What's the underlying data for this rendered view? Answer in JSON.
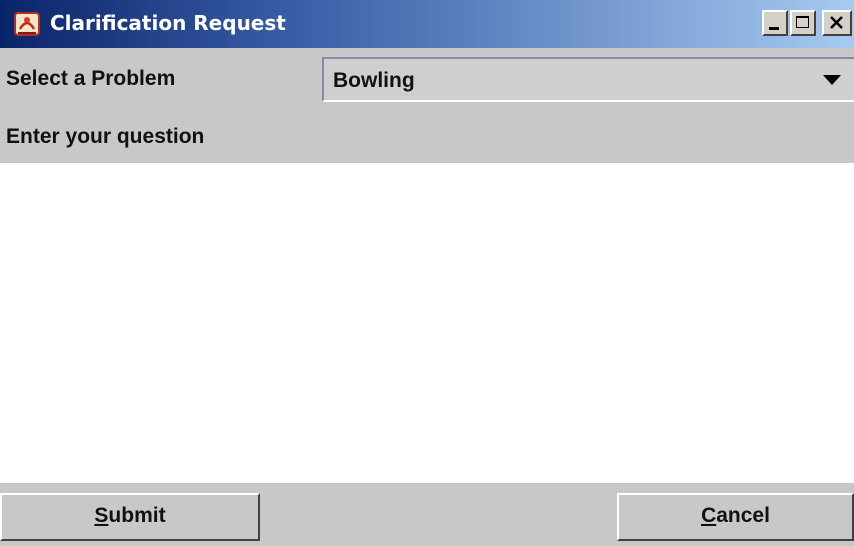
{
  "window": {
    "title": "Clarification Request",
    "app_icon": "java-duke-icon"
  },
  "title_buttons": {
    "minimize_icon": "minimize-icon",
    "maximize_icon": "maximize-icon",
    "close_icon": "close-icon"
  },
  "problem": {
    "label": "Select a Problem",
    "selected": "Bowling",
    "dropdown_icon": "chevron-down-icon"
  },
  "question": {
    "label": "Enter your question",
    "value": ""
  },
  "buttons": {
    "submit": {
      "mnemonic": "S",
      "rest": "ubmit"
    },
    "cancel": {
      "mnemonic": "C",
      "rest": "ancel"
    }
  },
  "colors": {
    "titlebar_start": "#0a246a",
    "titlebar_end": "#a6caf0",
    "background": "#c8c8c8"
  }
}
